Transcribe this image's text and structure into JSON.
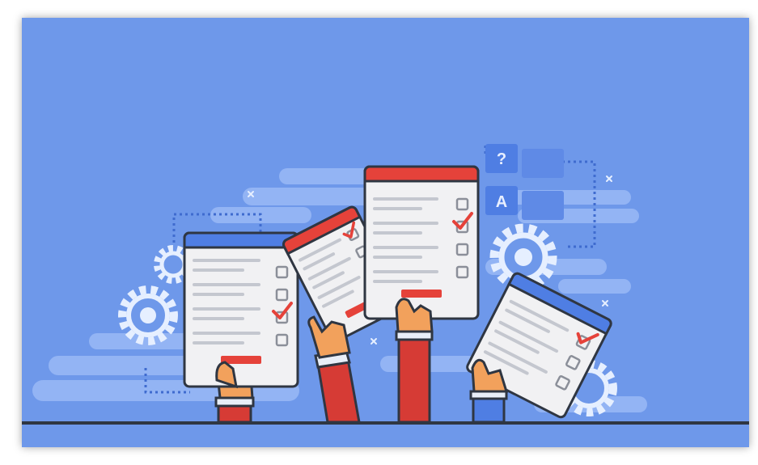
{
  "illustration": {
    "qa_card": {
      "question_symbol": "?",
      "answer_symbol": "A"
    }
  }
}
